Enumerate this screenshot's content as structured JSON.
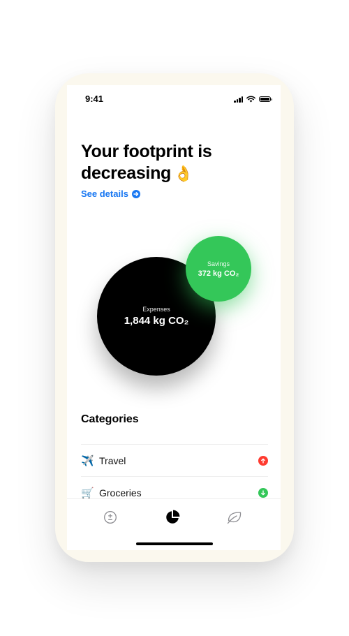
{
  "status_bar": {
    "time": "9:41"
  },
  "header": {
    "title": "Your footprint is decreasing",
    "title_emoji": "👌",
    "details_link": "See details"
  },
  "bubbles": {
    "expenses": {
      "label": "Expenses",
      "value": "1,844 kg CO₂"
    },
    "savings": {
      "label": "Savings",
      "value": "372 kg CO₂"
    }
  },
  "categories": {
    "title": "Categories",
    "items": [
      {
        "emoji": "✈️",
        "label": "Travel",
        "trend": "up"
      },
      {
        "emoji": "🛒",
        "label": "Groceries",
        "trend": "down"
      }
    ]
  },
  "tab_bar": {
    "tabs": [
      {
        "icon": "plus-minus-icon",
        "active": false
      },
      {
        "icon": "pie-chart-icon",
        "active": true
      },
      {
        "icon": "leaf-icon",
        "active": false
      }
    ]
  },
  "colors": {
    "accent_blue": "#1877f2",
    "savings_green": "#34c759",
    "alert_red": "#ff3b30",
    "frame_cream": "#fbf8ee"
  }
}
